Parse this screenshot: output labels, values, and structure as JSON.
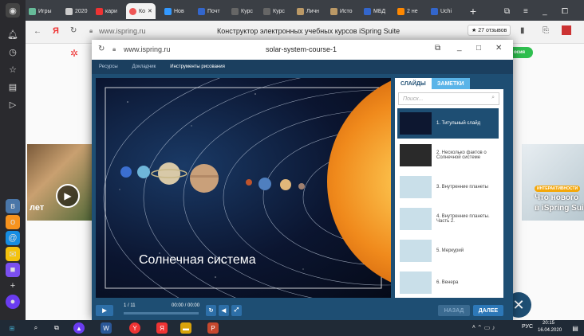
{
  "browser": {
    "tabs": [
      "Игры",
      "2020",
      "кари",
      "Ко",
      "Нов",
      "Почт",
      "Курс",
      "Курс",
      "Личн",
      "Исто",
      "МБД",
      "2 не",
      "Uchi"
    ],
    "url": "www.ispring.ru",
    "page_title": "Конструктор электронных учебных курсов iSpring Suite",
    "reviews": "★ 27 отзывов"
  },
  "page_behind": {
    "left_text": "лет",
    "right_badge": "ИНТЕРАКТИВНОСТИ",
    "right_title_1": "Что нового",
    "right_title_2": "в iSpring Sui",
    "green_btn": "осия"
  },
  "modal": {
    "url": "www.ispring.ru",
    "title": "solar-system-course-1",
    "nav": [
      "Ресурсы",
      "Докладчик",
      "Инструменты рисования"
    ],
    "slide_title": "Солнечная система",
    "panel": {
      "tabs": [
        "СЛАЙДЫ",
        "ЗАМЕТКИ"
      ],
      "search_placeholder": "Поиск...",
      "slides": [
        {
          "label": "1. Титульный слайд",
          "thumb": "#0d1730"
        },
        {
          "label": "2. Несколько фактов о Солнечной системе",
          "thumb": "#2a2a2a"
        },
        {
          "label": "3. Внутренние планеты",
          "thumb": "#c9dfe9"
        },
        {
          "label": "4. Внутренние планеты. Часть 2.",
          "thumb": "#c9dfe9"
        },
        {
          "label": "5. Меркурий",
          "thumb": "#c9dfe9"
        },
        {
          "label": "6. Венера",
          "thumb": "#c9dfe9"
        }
      ]
    },
    "controls": {
      "counter": "1 / 11",
      "time": "00:00 / 00:00",
      "prev": "НАЗАД",
      "next": "ДАЛЕЕ"
    }
  },
  "taskbar": {
    "lang": "РУС",
    "time": "20:15",
    "date": "16.04.2020"
  },
  "colors": {
    "accent": "#1e4e73",
    "sun": "#f08a1c",
    "green": "#2fbf4f"
  }
}
